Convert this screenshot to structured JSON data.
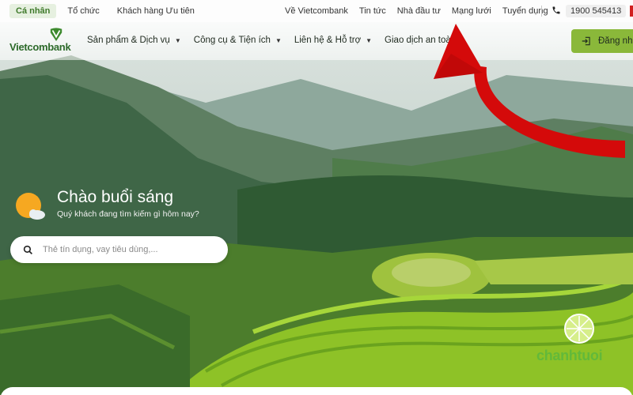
{
  "topbar": {
    "segments": [
      {
        "label": "Cá nhân",
        "active": true
      },
      {
        "label": "Tổ chức",
        "active": false
      },
      {
        "label": "Khách hàng Ưu tiên",
        "active": false
      }
    ],
    "links": [
      "Về Vietcombank",
      "Tin tức",
      "Nhà đầu tư",
      "Mạng lưới",
      "Tuyển dụng"
    ],
    "hotline": "1900 545413",
    "phone_icon": "phone-icon"
  },
  "nav": {
    "logo_text": "Vietcombank",
    "menu": [
      {
        "label": "Sản phẩm & Dịch vụ",
        "dropdown": true
      },
      {
        "label": "Công cụ & Tiện ích",
        "dropdown": true
      },
      {
        "label": "Liên hệ & Hỗ trợ",
        "dropdown": true
      },
      {
        "label": "Giao dịch an toàn",
        "dropdown": false
      }
    ],
    "login_label": "Đăng nhập",
    "login_icon": "login-icon"
  },
  "hero": {
    "greeting": "Chào buổi sáng",
    "subtitle": "Quý khách đang tìm kiếm gì hôm nay?",
    "weather_icon": "sun-cloud-icon"
  },
  "search": {
    "placeholder": "Thẻ tín dụng, vay tiêu dùng,...",
    "value": ""
  },
  "watermark": {
    "text": "chanhtuoi"
  },
  "colors": {
    "brand_green": "#2d6a2a",
    "login_bg": "#8ab83a",
    "arrow_red": "#d40a0a",
    "watermark_green": "#62b93a"
  }
}
